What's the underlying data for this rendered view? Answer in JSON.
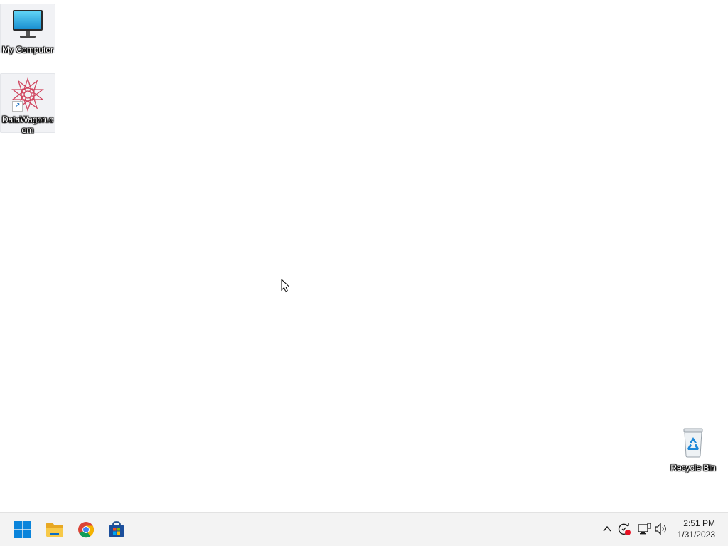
{
  "desktop": {
    "icons": [
      {
        "label": "My Computer",
        "icon": "monitor-icon"
      },
      {
        "label": "DataWagon.com",
        "icon": "datawagon-logo-icon",
        "shortcut": true
      },
      {
        "label": "Recycle Bin",
        "icon": "recycle-bin-icon"
      }
    ]
  },
  "taskbar": {
    "apps": [
      {
        "name": "Start",
        "icon": "windows-logo-icon"
      },
      {
        "name": "File Explorer",
        "icon": "folder-icon"
      },
      {
        "name": "Google Chrome",
        "icon": "chrome-icon"
      },
      {
        "name": "Microsoft Store",
        "icon": "store-icon"
      }
    ],
    "tray": {
      "icons": [
        "chevron-up-icon",
        "sync-alert-icon",
        "network-icon",
        "volume-icon"
      ]
    },
    "clock": {
      "time": "2:51 PM",
      "date": "1/31/2023"
    }
  },
  "colors": {
    "taskbar_bg": "#f3f3f3",
    "windows_blue": "#0078d4",
    "folder_yellow": "#f5c342",
    "alert_red": "#e81123"
  }
}
